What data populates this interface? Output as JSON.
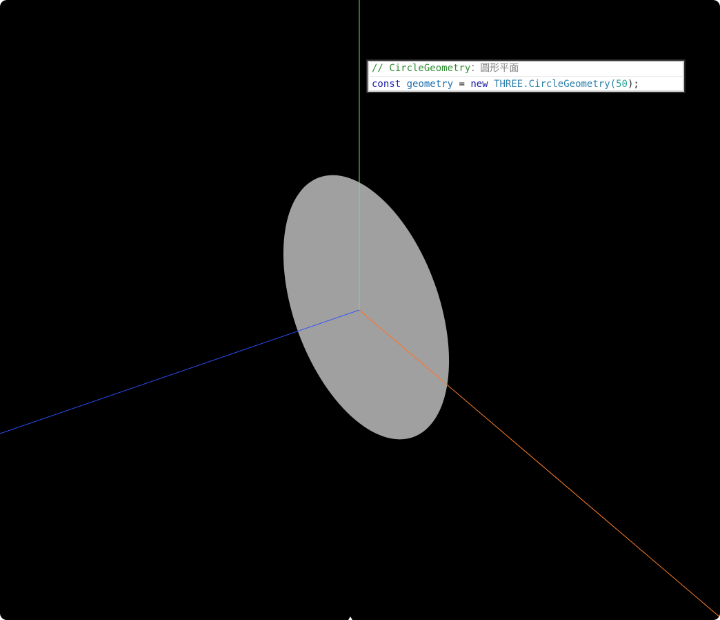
{
  "scene": {
    "background": "#000000",
    "disc_color": "#a0a0a0",
    "axes": {
      "x_color": "#ff7f2a",
      "y_color": "#7fd07f",
      "z_color": "#2b50ff"
    }
  },
  "code_panel": {
    "comment_prefix": "// CircleGeometry",
    "comment_sep": "：",
    "comment_cjk": "圆形平面",
    "kw_const": "const",
    "var_name": "geometry",
    "op_assign": " = ",
    "kw_new": "new",
    "class_name": "THREE.CircleGeometry",
    "paren_open": "(",
    "arg": "50",
    "paren_close": ");"
  }
}
